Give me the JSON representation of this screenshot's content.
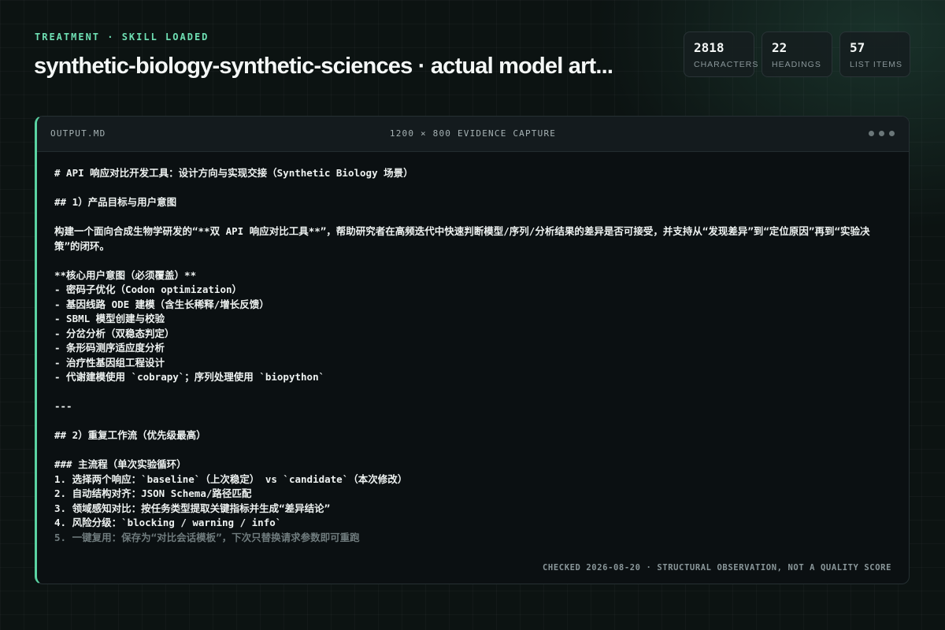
{
  "header": {
    "eyebrow": "TREATMENT · SKILL LOADED",
    "title": "synthetic-biology-synthetic-sciences · actual model art..."
  },
  "stats": [
    {
      "value": "2818",
      "label": "CHARACTERS"
    },
    {
      "value": "22",
      "label": "HEADINGS"
    },
    {
      "value": "57",
      "label": "LIST ITEMS"
    }
  ],
  "panel": {
    "filename": "OUTPUT.MD",
    "caption": "1200 × 800 EVIDENCE CAPTURE",
    "footer": "CHECKED 2026-08-20 · STRUCTURAL OBSERVATION, NOT A QUALITY SCORE",
    "lines": [
      "# API 响应对比开发工具：设计方向与实现交接（Synthetic Biology 场景）",
      "",
      "## 1）产品目标与用户意图",
      "",
      "构建一个面向合成生物学研发的“**双 API 响应对比工具**”，帮助研究者在高频迭代中快速判断模型/序列/分析结果的差异是否可接受，并支持从“发现差异”到“定位原因”再到“实验决策”的闭环。",
      "",
      "**核心用户意图（必须覆盖）**",
      "- 密码子优化（Codon optimization）",
      "- 基因线路 ODE 建模（含生长稀释/增长反馈）",
      "- SBML 模型创建与校验",
      "- 分岔分析（双稳态判定）",
      "- 条形码测序适应度分析",
      "- 治疗性基因组工程设计",
      "- 代谢建模使用 `cobrapy`；序列处理使用 `biopython`",
      "",
      "---",
      "",
      "## 2）重复工作流（优先级最高）",
      "",
      "### 主流程（单次实验循环）",
      "1. 选择两个响应：`baseline`（上次稳定） vs `candidate`（本次修改）",
      "2. 自动结构对齐：JSON Schema/路径匹配",
      "3. 领域感知对比：按任务类型提取关键指标并生成“差异结论”",
      "4. 风险分级：`blocking / warning / info`",
      "5. 一键复用：保存为“对比会话模板”，下次只替换请求参数即可重跑"
    ]
  }
}
